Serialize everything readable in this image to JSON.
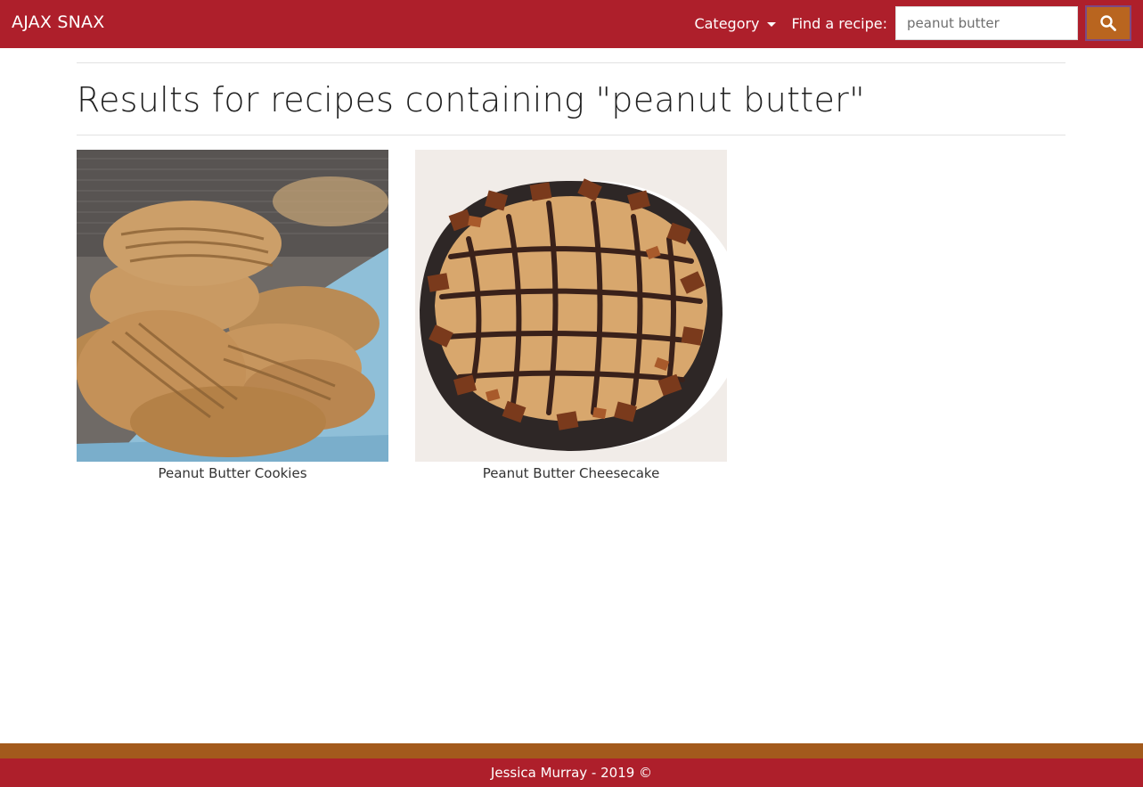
{
  "navbar": {
    "brand": "AJAX SNAX",
    "category_label": "Category",
    "find_label": "Find a recipe:",
    "search": {
      "value": "peanut butter",
      "placeholder": ""
    },
    "search_icon": "search-icon"
  },
  "main": {
    "title": "Results for recipes containing \"peanut butter\"",
    "results": [
      {
        "name": "Peanut Butter Cookies"
      },
      {
        "name": "Peanut Butter Cheesecake"
      }
    ]
  },
  "footer": {
    "text": "Jessica Murray - 2019 ©"
  },
  "colors": {
    "primary": "#ae1f2b",
    "accent": "#b9651f",
    "stripe": "#a35a1c"
  }
}
